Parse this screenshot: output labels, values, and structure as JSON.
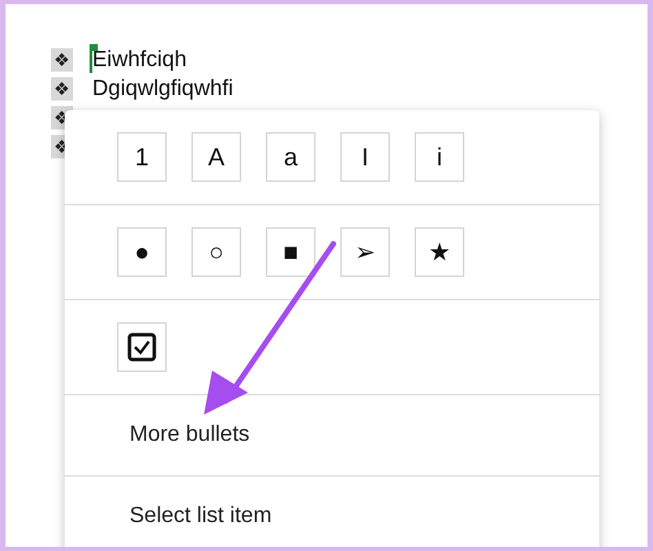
{
  "document": {
    "list": [
      {
        "bullet": "❖",
        "text": "Eiwhfciqh",
        "cursor": true
      },
      {
        "bullet": "❖",
        "text": "Dgiqwlgfiqwhfi",
        "cursor": false
      },
      {
        "bullet": "❖"
      },
      {
        "bullet": "❖"
      }
    ]
  },
  "menu": {
    "numbered_styles": [
      "1",
      "A",
      "a",
      "I",
      "i"
    ],
    "bullet_styles": [
      "●",
      "○",
      "■",
      "➢",
      "★"
    ],
    "checklist_styles": [
      {
        "kind": "checkbox",
        "checked": true
      }
    ],
    "items": [
      "More bullets",
      "Select list item"
    ]
  }
}
